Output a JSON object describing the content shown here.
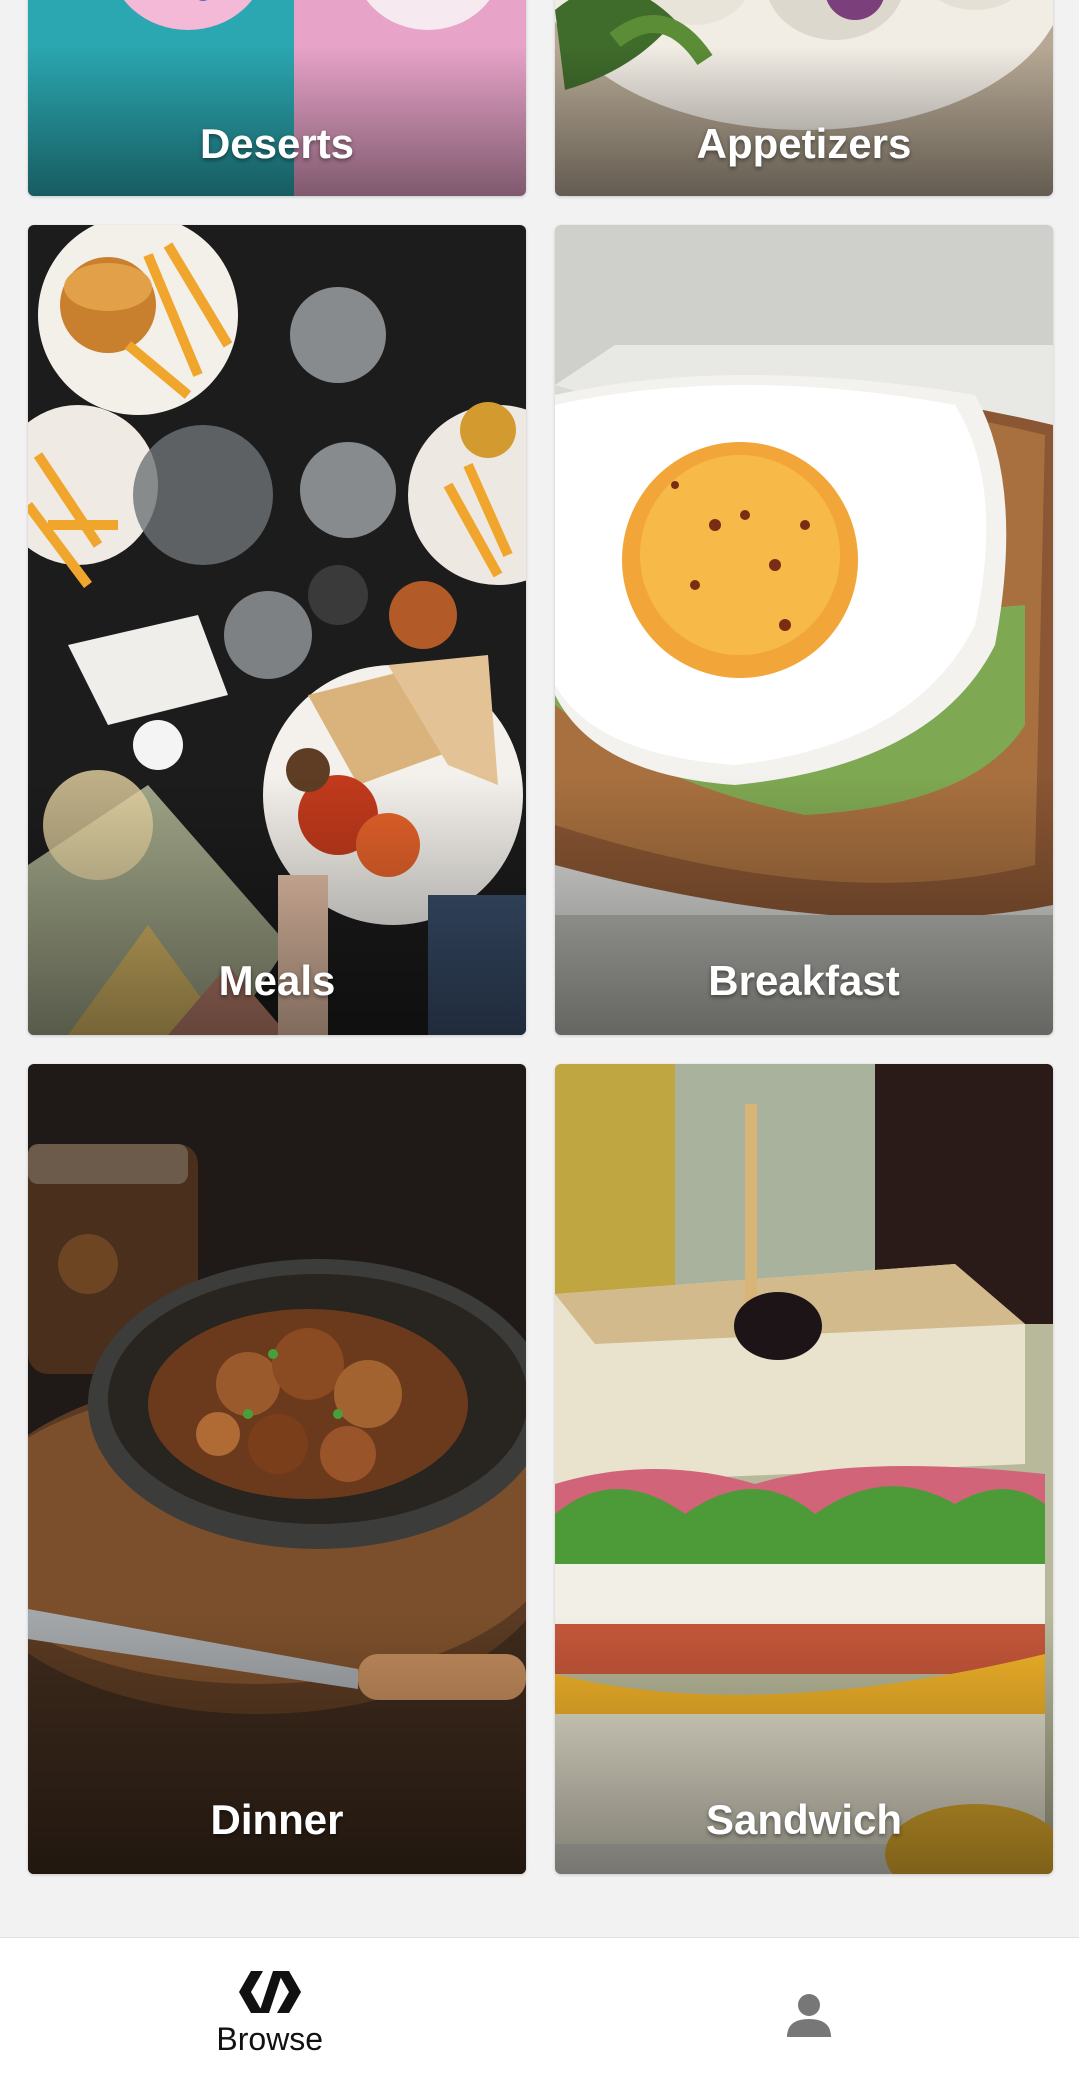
{
  "categories": [
    {
      "label": "Deserts"
    },
    {
      "label": "Appetizers"
    },
    {
      "label": "Meals"
    },
    {
      "label": "Breakfast"
    },
    {
      "label": "Dinner"
    },
    {
      "label": "Sandwich"
    }
  ],
  "bottom_nav": {
    "browse_label": "Browse",
    "browse_icon": "polymer-icon",
    "profile_icon": "person-icon"
  },
  "colors": {
    "background": "#f2f2f2",
    "nav_background": "#ffffff",
    "label_text": "#ffffff",
    "nav_icon_active": "#111111",
    "nav_icon_inactive": "#777777"
  }
}
